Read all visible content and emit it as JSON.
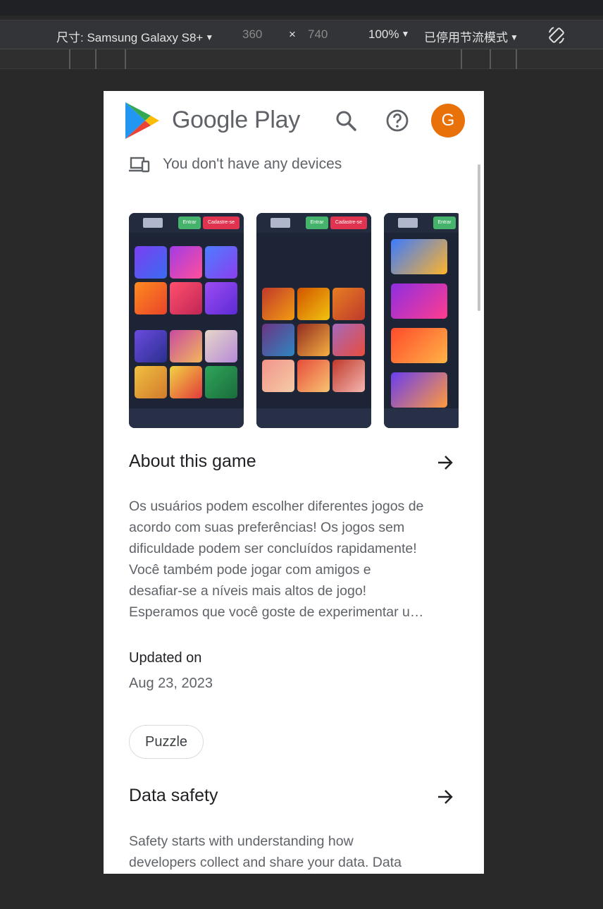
{
  "devtools": {
    "device_label": "尺寸: Samsung Galaxy S8+",
    "width": "360",
    "times": "×",
    "height": "740",
    "zoom": "100%",
    "throttle": "已停用节流模式"
  },
  "header": {
    "title": "Google Play",
    "avatar_initial": "G"
  },
  "devices_notice": "You don't have any devices",
  "screenshots": [
    {
      "btn_login": "Entrar",
      "btn_signup": "Cadastre-se"
    },
    {
      "btn_login": "Entrar",
      "btn_signup": "Cadastre-se"
    },
    {
      "btn_login": "Entrar"
    }
  ],
  "about": {
    "title": "About this game",
    "lines": [
      "Os usuários podem escolher diferentes jogos de",
      "acordo com suas preferências! Os jogos sem",
      "dificuldade podem ser concluídos rapidamente!",
      "Você também pode jogar com amigos e",
      "desafiar-se a níveis mais altos de jogo!",
      "Esperamos que você goste de experimentar u…"
    ]
  },
  "updated": {
    "label": "Updated on",
    "date": "Aug 23, 2023"
  },
  "category_chip": "Puzzle",
  "data_safety": {
    "title": "Data safety",
    "lines": [
      "Safety starts with understanding how",
      "developers collect and share your data. Data"
    ]
  },
  "colors": {
    "avatar": "#e8710a",
    "text_primary": "#202124",
    "text_secondary": "#5f6368"
  }
}
